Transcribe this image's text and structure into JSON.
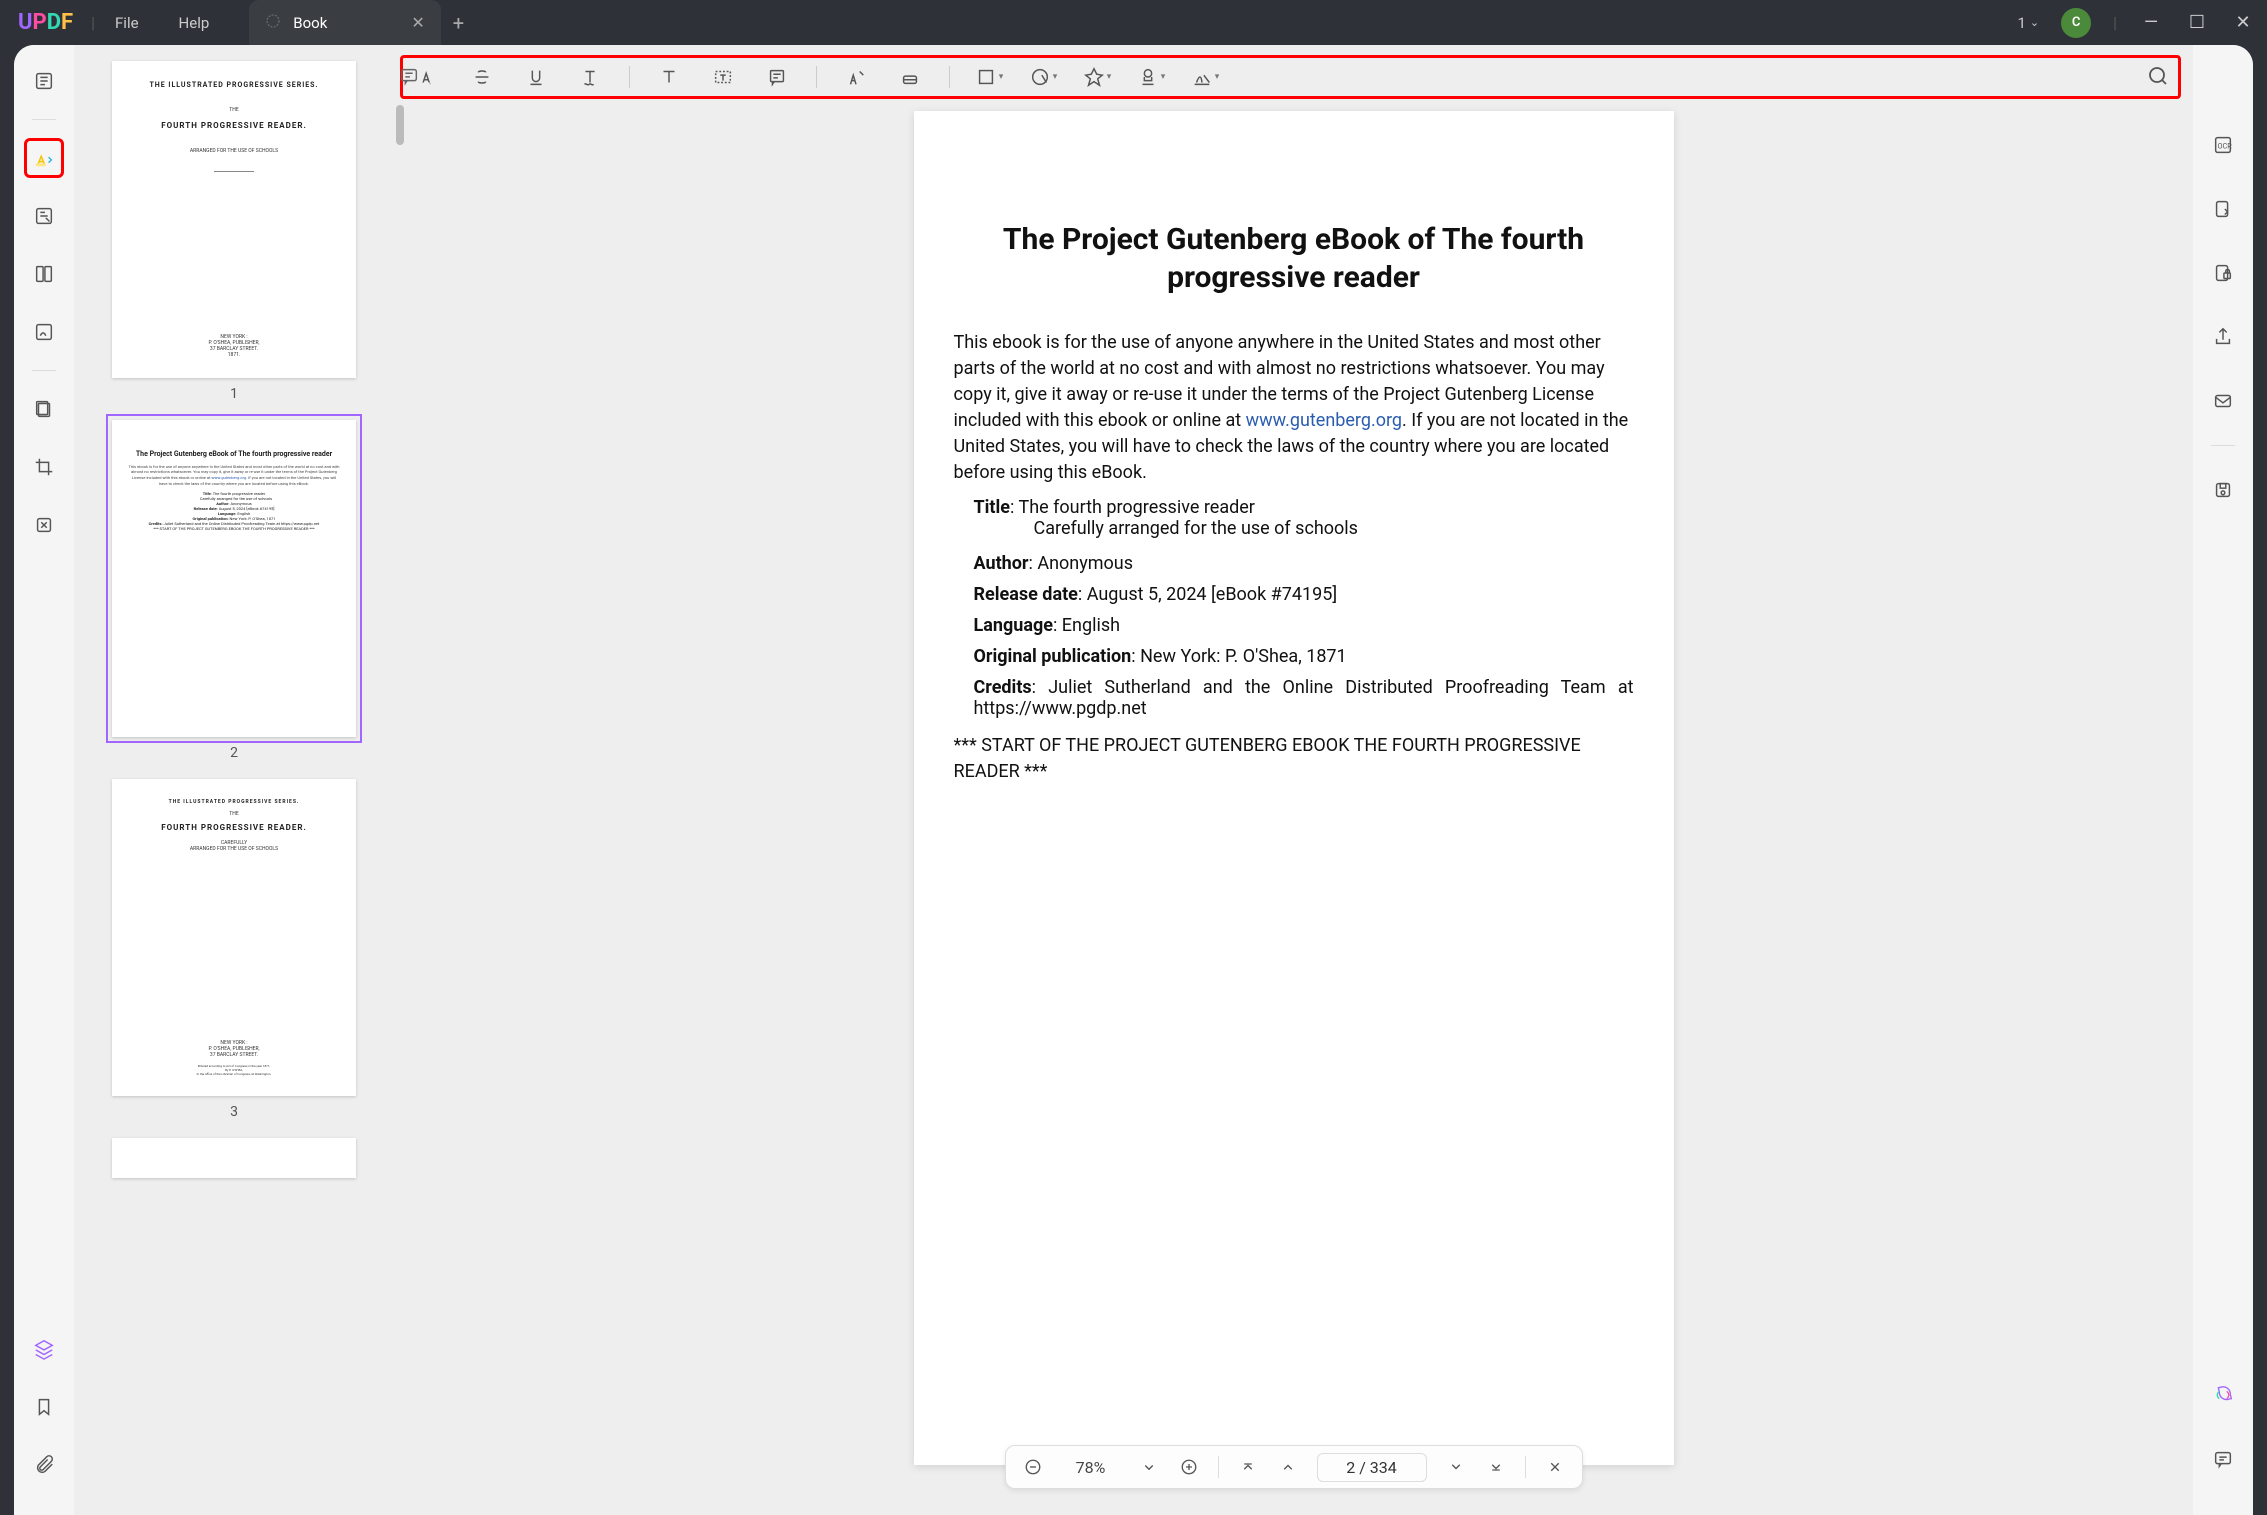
{
  "titlebar": {
    "menus": {
      "file": "File",
      "help": "Help"
    },
    "tab_label": "Book",
    "doc_count": "1",
    "avatar_initial": "C"
  },
  "left_rail": {
    "tools": [
      "reader",
      "comment",
      "edit",
      "pages",
      "fill",
      "crop",
      "tools-batch"
    ],
    "bottom": [
      "layers",
      "bookmark",
      "attachment"
    ]
  },
  "annotation_toolbar": {
    "tools": [
      "highlight",
      "strikethrough",
      "underline",
      "squiggly",
      "text",
      "textbox",
      "note",
      "pencil",
      "eraser",
      "rectangle",
      "shape",
      "pin",
      "stamp",
      "signature"
    ]
  },
  "thumbnails": [
    {
      "num": "1",
      "title_top": "THE ILLUSTRATED PROGRESSIVE SERIES.",
      "mid": "THE",
      "main": "FOURTH  PROGRESSIVE  READER.",
      "sub": "ARRANGED FOR THE USE OF SCHOOLS",
      "pub": "NEW YORK :\nP. O'SHEA, PUBLISHER,\n37 BARCLAY STREET.\n1871."
    },
    {
      "num": "2",
      "selected": true,
      "title": "The Project Gutenberg eBook of The fourth progressive reader"
    },
    {
      "num": "3",
      "title_top": "THE ILLUSTRATED PROGRESSIVE SERIES.",
      "mid": "THE",
      "main": "FOURTH PROGRESSIVE READER.",
      "sub": "CAREFULLY\nARRANGED FOR THE USE OF SCHOOLS",
      "pub": "NEW YORK :\nP. O'SHEA, PUBLISHER,\n37 BARCLAY STREET."
    }
  ],
  "document": {
    "title": "The Project Gutenberg eBook of The fourth progressive reader",
    "para1a": "This ebook is for the use of anyone anywhere in the United States and most other parts of the world at no cost and with almost no restrictions whatsoever. You may copy it, give it away or re-use it under the terms of the Project Gutenberg License included with this ebook or online at ",
    "link": "www.gutenberg.org",
    "para1b": ". If you are not located in the United States, you will have to check the laws of the country where you are located before using this eBook.",
    "fields": {
      "title_label": "Title",
      "title_val": ": The fourth progressive reader",
      "subtitle": "Carefully arranged for the use of schools",
      "author_label": "Author",
      "author_val": ": Anonymous",
      "release_label": "Release date",
      "release_val": ": August 5, 2024 [eBook #74195]",
      "lang_label": "Language",
      "lang_val": ": English",
      "orig_label": "Original publication",
      "orig_val": ": New York: P. O'Shea, 1871",
      "credits_label": "Credits",
      "credits_val": ": Juliet Sutherland and the Online Distributed Proofreading Team at https://www.pgdp.net"
    },
    "start": "*** START OF THE PROJECT GUTENBERG EBOOK THE FOURTH PROGRESSIVE READER ***"
  },
  "pagebar": {
    "zoom": "78%",
    "page_current": "2",
    "page_sep": " / ",
    "page_total": "334"
  },
  "right_rail": {
    "tools": [
      "ocr",
      "protect",
      "redact",
      "share",
      "email",
      "save"
    ],
    "bottom": [
      "ai-assistant",
      "chat"
    ]
  },
  "colors": {
    "highlight_red": "#f00",
    "accent": "#a066ff"
  }
}
